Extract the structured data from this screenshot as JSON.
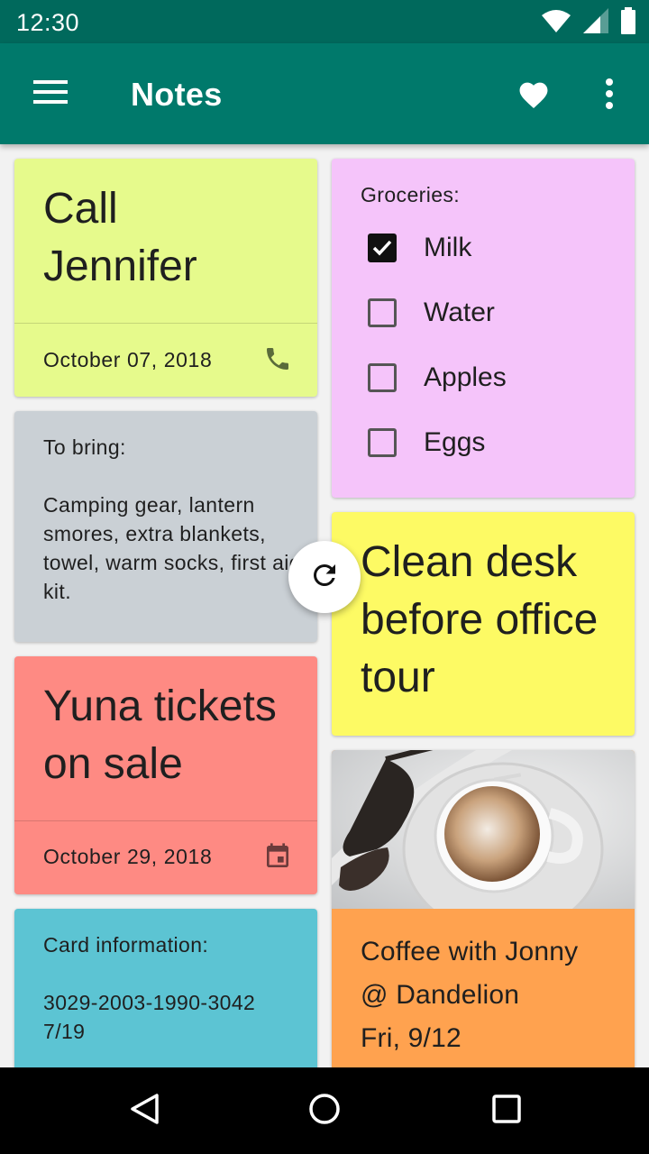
{
  "status_bar": {
    "time": "12:30",
    "icons": [
      "wifi-icon",
      "signal-icon",
      "battery-icon"
    ]
  },
  "app_bar": {
    "title": "Notes",
    "icons": [
      "menu-icon",
      "heart-icon",
      "more-vert-icon"
    ]
  },
  "notes": {
    "call_jennifer": {
      "title": "Call Jennifer",
      "date": "October 07, 2018",
      "icon": "phone-icon",
      "color": "#e6fa8c"
    },
    "to_bring": {
      "heading": "To bring:",
      "body": "Camping gear, lantern smores, extra blankets, towel, warm socks, first aid kit.",
      "color": "#cad0d5"
    },
    "yuna": {
      "title": "Yuna tickets on sale",
      "date": "October 29, 2018",
      "icon": "calendar-icon",
      "color": "#fe8a83"
    },
    "card_info": {
      "heading": "Card information:",
      "number": "3029-2003-1990-3042",
      "expiry": "7/19",
      "color": "#5cc4d3"
    },
    "groceries": {
      "heading": "Groceries:",
      "items": [
        {
          "label": "Milk",
          "checked": true
        },
        {
          "label": "Water",
          "checked": false
        },
        {
          "label": "Apples",
          "checked": false
        },
        {
          "label": "Eggs",
          "checked": false
        }
      ],
      "color": "#f5c4fa"
    },
    "clean_desk": {
      "title": "Clean desk before office tour",
      "color": "#fdfa64"
    },
    "coffee": {
      "line1": "Coffee with Jonny",
      "line2": "@ Dandelion",
      "line3": "Fri, 9/12",
      "color": "#ffa24f",
      "image": "coffee-photo"
    }
  },
  "fab": {
    "icon": "refresh-icon"
  },
  "nav": {
    "icons": [
      "back-icon",
      "home-icon",
      "recents-icon"
    ]
  },
  "colors": {
    "status_bar": "#00695c",
    "app_bar": "#00796b"
  }
}
